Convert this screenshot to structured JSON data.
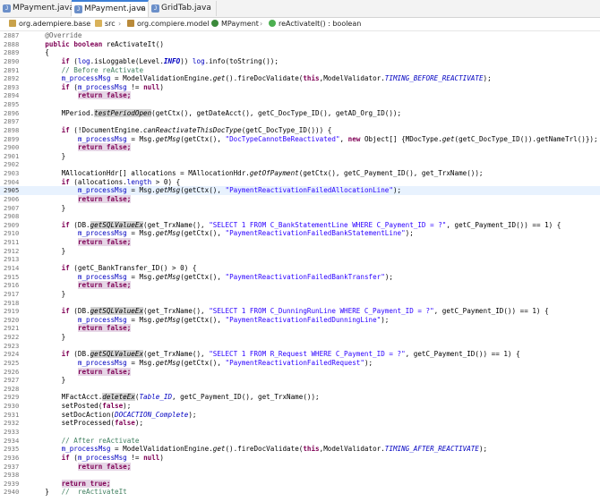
{
  "tabs": [
    {
      "label": "MPayment.java",
      "active": false
    },
    {
      "label": "MPayment.java",
      "active": true
    },
    {
      "label": "GridTab.java",
      "active": false
    }
  ],
  "breadcrumb": [
    "org.adempiere.base",
    "src",
    "org.compiere.model",
    "MPayment",
    "reActivateIt() : boolean"
  ],
  "current_line": 2905,
  "colors": {
    "keyword": "#7f0055",
    "field": "#0000c0",
    "string": "#2a00ff",
    "comment": "#3f7f5f",
    "current_line": "#e8f2fe"
  },
  "code_lines": [
    {
      "n": "2887",
      "t": [
        [
          "    ",
          ""
        ],
        [
          "@Override",
          "an"
        ]
      ]
    },
    {
      "n": "2888",
      "t": [
        [
          "    ",
          ""
        ],
        [
          "public",
          "kw"
        ],
        [
          " ",
          ""
        ],
        [
          "boolean",
          "kw"
        ],
        [
          " reActivateIt()",
          ""
        ]
      ]
    },
    {
      "n": "2889",
      "t": [
        [
          "    {",
          ""
        ]
      ]
    },
    {
      "n": "2890",
      "t": [
        [
          "        ",
          ""
        ],
        [
          "if",
          "kw"
        ],
        [
          " (",
          ""
        ],
        [
          "log",
          "fld"
        ],
        [
          ".isLoggable(Level.",
          ""
        ],
        [
          "INFO",
          "stf"
        ],
        [
          ")) ",
          ""
        ],
        [
          "log",
          "fld"
        ],
        [
          ".info(toString());",
          ""
        ]
      ]
    },
    {
      "n": "2891",
      "t": [
        [
          "        ",
          ""
        ],
        [
          "// Before reActivate",
          "cm"
        ]
      ]
    },
    {
      "n": "2892",
      "t": [
        [
          "        ",
          ""
        ],
        [
          "m_processMsg",
          "fld"
        ],
        [
          " = ModelValidationEngine.",
          ""
        ],
        [
          "get",
          "it"
        ],
        [
          "().fireDocValidate(",
          ""
        ],
        [
          "this",
          "kw"
        ],
        [
          ",ModelValidator.",
          ""
        ],
        [
          "TIMING_BEFORE_REACTIVATE",
          "st"
        ],
        [
          ");",
          ""
        ]
      ]
    },
    {
      "n": "2893",
      "t": [
        [
          "        ",
          ""
        ],
        [
          "if",
          "kw"
        ],
        [
          " (",
          ""
        ],
        [
          "m_processMsg",
          "fld"
        ],
        [
          " != ",
          ""
        ],
        [
          "null",
          "kw"
        ],
        [
          ")",
          ""
        ]
      ]
    },
    {
      "n": "2894",
      "t": [
        [
          "            ",
          ""
        ],
        [
          "return false;",
          "kw hl"
        ]
      ]
    },
    {
      "n": "2895",
      "t": [
        [
          "",
          ""
        ]
      ]
    },
    {
      "n": "2896",
      "t": [
        [
          "        MPeriod.",
          ""
        ],
        [
          "testPeriodOpen",
          "it occ"
        ],
        [
          "(getCtx(), getDateAcct(), getC_DocType_ID(), getAD_Org_ID());",
          ""
        ]
      ]
    },
    {
      "n": "2897",
      "t": [
        [
          "",
          ""
        ]
      ]
    },
    {
      "n": "2898",
      "t": [
        [
          "        ",
          ""
        ],
        [
          "if",
          "kw"
        ],
        [
          " (!DocumentEngine.",
          ""
        ],
        [
          "canReactivateThisDocType",
          "it"
        ],
        [
          "(getC_DocType_ID())) {",
          ""
        ]
      ]
    },
    {
      "n": "2899",
      "t": [
        [
          "            ",
          ""
        ],
        [
          "m_processMsg",
          "fld"
        ],
        [
          " = Msg.",
          ""
        ],
        [
          "getMsg",
          "it"
        ],
        [
          "(getCtx(), ",
          ""
        ],
        [
          "\"DocTypeCannotBeReactivated\"",
          "str"
        ],
        [
          ", ",
          ""
        ],
        [
          "new",
          "kw"
        ],
        [
          " Object[] {MDocType.",
          ""
        ],
        [
          "get",
          "it"
        ],
        [
          "(getC_DocType_ID()).getNameTrl()});",
          ""
        ]
      ]
    },
    {
      "n": "2900",
      "t": [
        [
          "            ",
          ""
        ],
        [
          "return false;",
          "kw hl"
        ]
      ]
    },
    {
      "n": "2901",
      "t": [
        [
          "        }",
          ""
        ]
      ]
    },
    {
      "n": "2902",
      "t": [
        [
          "",
          ""
        ]
      ]
    },
    {
      "n": "2903",
      "t": [
        [
          "        MAllocationHdr[] allocations = MAllocationHdr.",
          ""
        ],
        [
          "getOfPayment",
          "it"
        ],
        [
          "(getCtx(), getC_Payment_ID(), get_TrxName());",
          ""
        ]
      ]
    },
    {
      "n": "2904",
      "t": [
        [
          "        ",
          ""
        ],
        [
          "if",
          "kw"
        ],
        [
          " (allocations.",
          ""
        ],
        [
          "length",
          "fld"
        ],
        [
          " > 0) {",
          ""
        ]
      ]
    },
    {
      "n": "2905",
      "t": [
        [
          "            ",
          ""
        ],
        [
          "m_processMsg",
          "fld"
        ],
        [
          " = Msg.",
          ""
        ],
        [
          "getMsg",
          "it"
        ],
        [
          "(getCtx(), ",
          ""
        ],
        [
          "\"PaymentReactivationFailedAllocationLine\"",
          "str"
        ],
        [
          ");",
          ""
        ]
      ]
    },
    {
      "n": "2906",
      "t": [
        [
          "            ",
          ""
        ],
        [
          "return false;",
          "kw hl"
        ]
      ]
    },
    {
      "n": "2907",
      "t": [
        [
          "        }",
          ""
        ]
      ]
    },
    {
      "n": "2908",
      "t": [
        [
          "",
          ""
        ]
      ]
    },
    {
      "n": "2909",
      "t": [
        [
          "        ",
          ""
        ],
        [
          "if",
          "kw"
        ],
        [
          " (DB.",
          ""
        ],
        [
          "getSQLValueEx",
          "it occ"
        ],
        [
          "(get_TrxName(), ",
          ""
        ],
        [
          "\"SELECT 1 FROM C_BankStatementLine WHERE C_Payment_ID = ?\"",
          "str"
        ],
        [
          ", getC_Payment_ID()) == 1) {",
          ""
        ]
      ]
    },
    {
      "n": "2910",
      "t": [
        [
          "            ",
          ""
        ],
        [
          "m_processMsg",
          "fld"
        ],
        [
          " = Msg.",
          ""
        ],
        [
          "getMsg",
          "it"
        ],
        [
          "(getCtx(), ",
          ""
        ],
        [
          "\"PaymentReactivationFailedBankStatementLine\"",
          "str"
        ],
        [
          ");",
          ""
        ]
      ]
    },
    {
      "n": "2911",
      "t": [
        [
          "            ",
          ""
        ],
        [
          "return false;",
          "kw hl"
        ]
      ]
    },
    {
      "n": "2912",
      "t": [
        [
          "        }",
          ""
        ]
      ]
    },
    {
      "n": "2913",
      "t": [
        [
          "",
          ""
        ]
      ]
    },
    {
      "n": "2914",
      "t": [
        [
          "        ",
          ""
        ],
        [
          "if",
          "kw"
        ],
        [
          " (getC_BankTransfer_ID() > 0) {",
          ""
        ]
      ]
    },
    {
      "n": "2915",
      "t": [
        [
          "            ",
          ""
        ],
        [
          "m_processMsg",
          "fld"
        ],
        [
          " = Msg.",
          ""
        ],
        [
          "getMsg",
          "it"
        ],
        [
          "(getCtx(), ",
          ""
        ],
        [
          "\"PaymentReactivationFailedBankTransfer\"",
          "str"
        ],
        [
          ");",
          ""
        ]
      ]
    },
    {
      "n": "2916",
      "t": [
        [
          "            ",
          ""
        ],
        [
          "return false;",
          "kw hl"
        ]
      ]
    },
    {
      "n": "2917",
      "t": [
        [
          "        }",
          ""
        ]
      ]
    },
    {
      "n": "2918",
      "t": [
        [
          "",
          ""
        ]
      ]
    },
    {
      "n": "2919",
      "t": [
        [
          "        ",
          ""
        ],
        [
          "if",
          "kw"
        ],
        [
          " (DB.",
          ""
        ],
        [
          "getSQLValueEx",
          "it occ"
        ],
        [
          "(get_TrxName(), ",
          ""
        ],
        [
          "\"SELECT 1 FROM C_DunningRunLine WHERE C_Payment_ID = ?\"",
          "str"
        ],
        [
          ", getC_Payment_ID()) == 1) {",
          ""
        ]
      ]
    },
    {
      "n": "2920",
      "t": [
        [
          "            ",
          ""
        ],
        [
          "m_processMsg",
          "fld"
        ],
        [
          " = Msg.",
          ""
        ],
        [
          "getMsg",
          "it"
        ],
        [
          "(getCtx(), ",
          ""
        ],
        [
          "\"PaymentReactivationFailedDunningLine\"",
          "str"
        ],
        [
          ");",
          ""
        ]
      ]
    },
    {
      "n": "2921",
      "t": [
        [
          "            ",
          ""
        ],
        [
          "return false;",
          "kw hl"
        ]
      ]
    },
    {
      "n": "2922",
      "t": [
        [
          "        }",
          ""
        ]
      ]
    },
    {
      "n": "2923",
      "t": [
        [
          "",
          ""
        ]
      ]
    },
    {
      "n": "2924",
      "t": [
        [
          "        ",
          ""
        ],
        [
          "if",
          "kw"
        ],
        [
          " (DB.",
          ""
        ],
        [
          "getSQLValueEx",
          "it occ"
        ],
        [
          "(get_TrxName(), ",
          ""
        ],
        [
          "\"SELECT 1 FROM R_Request WHERE C_Payment_ID = ?\"",
          "str"
        ],
        [
          ", getC_Payment_ID()) == 1) {",
          ""
        ]
      ]
    },
    {
      "n": "2925",
      "t": [
        [
          "            ",
          ""
        ],
        [
          "m_processMsg",
          "fld"
        ],
        [
          " = Msg.",
          ""
        ],
        [
          "getMsg",
          "it"
        ],
        [
          "(getCtx(), ",
          ""
        ],
        [
          "\"PaymentReactivationFailedRequest\"",
          "str"
        ],
        [
          ");",
          ""
        ]
      ]
    },
    {
      "n": "2926",
      "t": [
        [
          "            ",
          ""
        ],
        [
          "return false;",
          "kw hl"
        ]
      ]
    },
    {
      "n": "2927",
      "t": [
        [
          "        }",
          ""
        ]
      ]
    },
    {
      "n": "2928",
      "t": [
        [
          "",
          ""
        ]
      ]
    },
    {
      "n": "2929",
      "t": [
        [
          "        MFactAcct.",
          ""
        ],
        [
          "deleteEx",
          "it occ"
        ],
        [
          "(",
          ""
        ],
        [
          "Table_ID",
          "st"
        ],
        [
          ", getC_Payment_ID(), get_TrxName());",
          ""
        ]
      ]
    },
    {
      "n": "2930",
      "t": [
        [
          "        setPosted(",
          ""
        ],
        [
          "false",
          "kw"
        ],
        [
          ");",
          ""
        ]
      ]
    },
    {
      "n": "2931",
      "t": [
        [
          "        setDocAction(",
          ""
        ],
        [
          "DOCACTION_Complete",
          "st"
        ],
        [
          ");",
          ""
        ]
      ]
    },
    {
      "n": "2932",
      "t": [
        [
          "        setProcessed(",
          ""
        ],
        [
          "false",
          "kw"
        ],
        [
          ");",
          ""
        ]
      ]
    },
    {
      "n": "2933",
      "t": [
        [
          "",
          ""
        ]
      ]
    },
    {
      "n": "2934",
      "t": [
        [
          "        ",
          ""
        ],
        [
          "// After reActivate",
          "cm"
        ]
      ]
    },
    {
      "n": "2935",
      "t": [
        [
          "        ",
          ""
        ],
        [
          "m_processMsg",
          "fld"
        ],
        [
          " = ModelValidationEngine.",
          ""
        ],
        [
          "get",
          "it"
        ],
        [
          "().fireDocValidate(",
          ""
        ],
        [
          "this",
          "kw"
        ],
        [
          ",ModelValidator.",
          ""
        ],
        [
          "TIMING_AFTER_REACTIVATE",
          "st"
        ],
        [
          ");",
          ""
        ]
      ]
    },
    {
      "n": "2936",
      "t": [
        [
          "        ",
          ""
        ],
        [
          "if",
          "kw"
        ],
        [
          " (",
          ""
        ],
        [
          "m_processMsg",
          "fld"
        ],
        [
          " != ",
          ""
        ],
        [
          "null",
          "kw"
        ],
        [
          ")",
          ""
        ]
      ]
    },
    {
      "n": "2937",
      "t": [
        [
          "            ",
          ""
        ],
        [
          "return false;",
          "kw hl"
        ]
      ]
    },
    {
      "n": "2938",
      "t": [
        [
          "",
          ""
        ]
      ]
    },
    {
      "n": "2939",
      "t": [
        [
          "        ",
          ""
        ],
        [
          "return true;",
          "kw hl"
        ]
      ]
    },
    {
      "n": "2940",
      "t": [
        [
          "    }   ",
          ""
        ],
        [
          "//  reActivateIt",
          "cm"
        ]
      ]
    }
  ]
}
